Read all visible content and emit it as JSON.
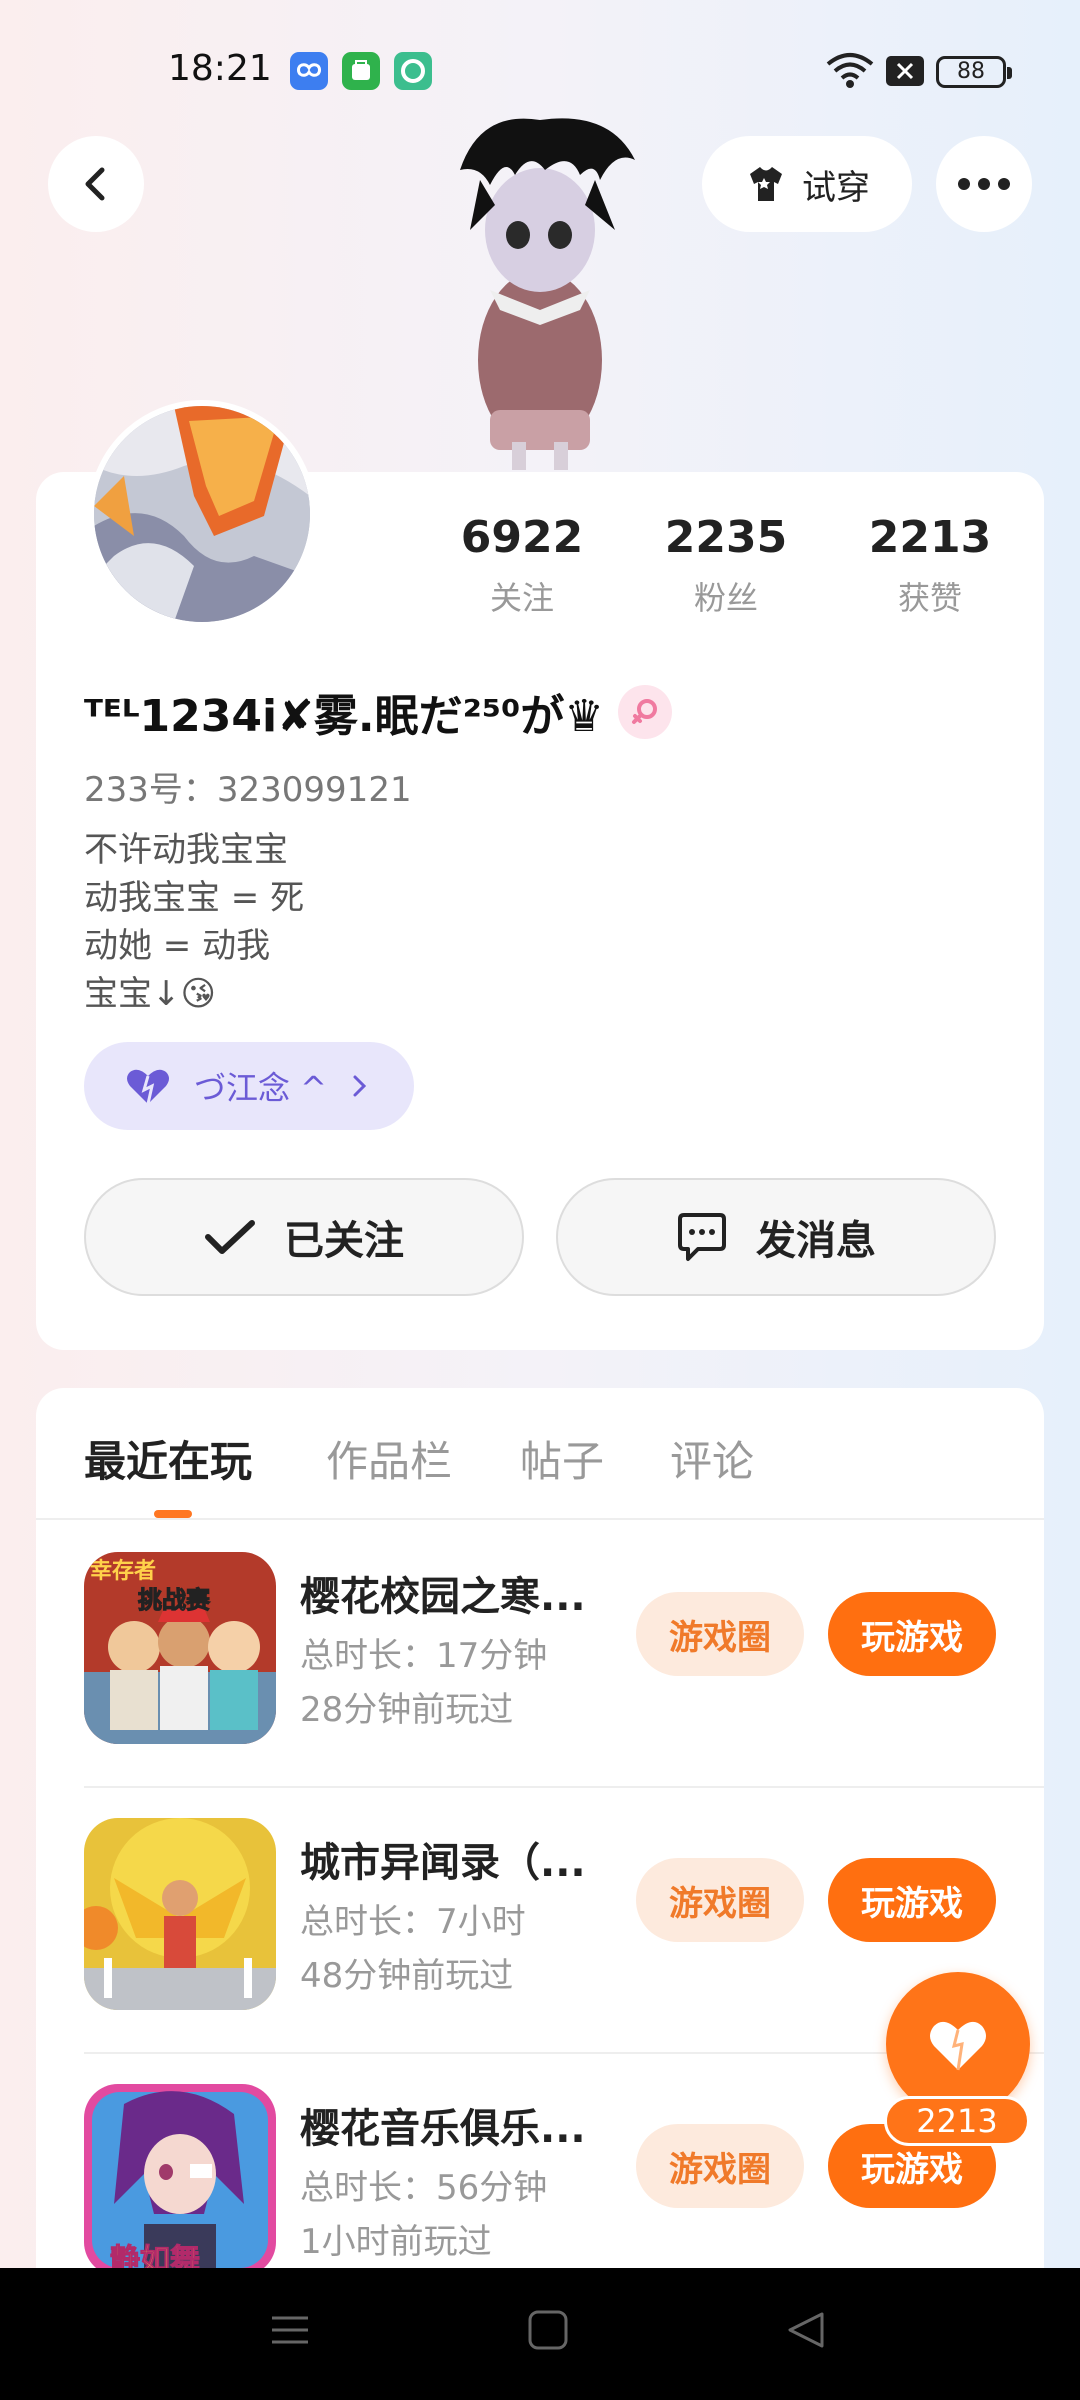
{
  "status_bar": {
    "time": "18:21",
    "notification_icons": [
      "cloud-app-icon",
      "shopping-app-icon",
      "camera-app-icon"
    ],
    "battery": "88"
  },
  "header": {
    "tryon_label": "试穿"
  },
  "profile": {
    "stats": [
      {
        "value": "6922",
        "label": "关注"
      },
      {
        "value": "2235",
        "label": "粉丝"
      },
      {
        "value": "2213",
        "label": "获赞"
      }
    ],
    "username": "ᵀᴱᴸ1234i✘雾.眠だ²⁵⁰が♛",
    "uid": "233号：323099121",
    "bio": [
      "不许动我宝宝",
      "动我宝宝 = 死",
      "动她 = 动我",
      "宝宝↓😘"
    ],
    "tag": "づ江念 ^",
    "follow_label": "已关注",
    "message_label": "发消息"
  },
  "tabs": [
    {
      "label": "最近在玩",
      "active": true
    },
    {
      "label": "作品栏",
      "active": false
    },
    {
      "label": "帖子",
      "active": false
    },
    {
      "label": "评论",
      "active": false
    }
  ],
  "games": [
    {
      "title": "樱花校园之寒...",
      "duration": "总时长：17分钟",
      "last_played": "28分钟前玩过",
      "circle_label": "游戏圈",
      "play_label": "玩游戏",
      "thumb_text_top": "幸存者",
      "thumb_text_sub": "挑战赛"
    },
    {
      "title": "城市异闻录（...",
      "duration": "总时长：7小时",
      "last_played": "48分钟前玩过",
      "circle_label": "游戏圈",
      "play_label": "玩游戏"
    },
    {
      "title": "樱花音乐俱乐...",
      "duration": "总时长：56分钟",
      "last_played": "1小时前玩过",
      "circle_label": "游戏圈",
      "play_label": "玩游戏",
      "thumb_text_sub": "静如舞"
    }
  ],
  "like_fab": {
    "count": "2213"
  },
  "colors": {
    "accent": "#ff7418",
    "tag_bg": "#e8e6fb",
    "tag_text": "#6b5bd6"
  }
}
